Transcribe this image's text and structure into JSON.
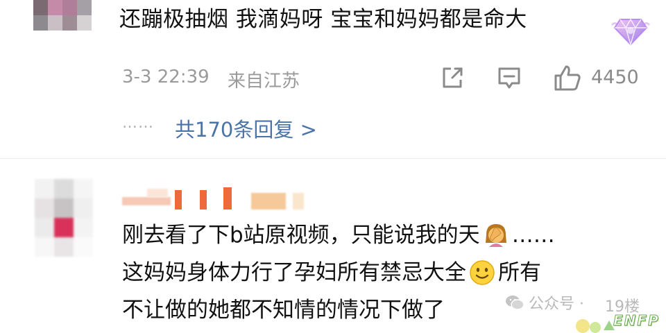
{
  "comment1": {
    "text": "还蹦极抽烟 我滴妈呀 宝宝和妈妈都是命大",
    "time": "3-3 22:39",
    "location": "来自江苏",
    "like_count": "4450",
    "more_dots": "……",
    "replies_link": "共170条回复 >"
  },
  "comment2": {
    "line1_before": "刚去看了下b站原视频，只能说我的天",
    "line1_after": "……",
    "line2_before": "这妈妈身体力行了孕妇所有禁忌大全",
    "line2_after": "所有",
    "line3": "不让做的她都不知情的情况下做了"
  },
  "watermark": {
    "source": "公众号 ·",
    "floor": "19楼",
    "sticker": "ENFP"
  },
  "icons": [
    "share-icon",
    "comment-icon",
    "like-icon",
    "wechat-icon",
    "facepalm-emoji",
    "smile-emoji",
    "diamond-badge-icon"
  ],
  "colors": {
    "link": "#4a73a8",
    "meta": "#9a9a9a",
    "bubble": "#f6fbf5"
  }
}
